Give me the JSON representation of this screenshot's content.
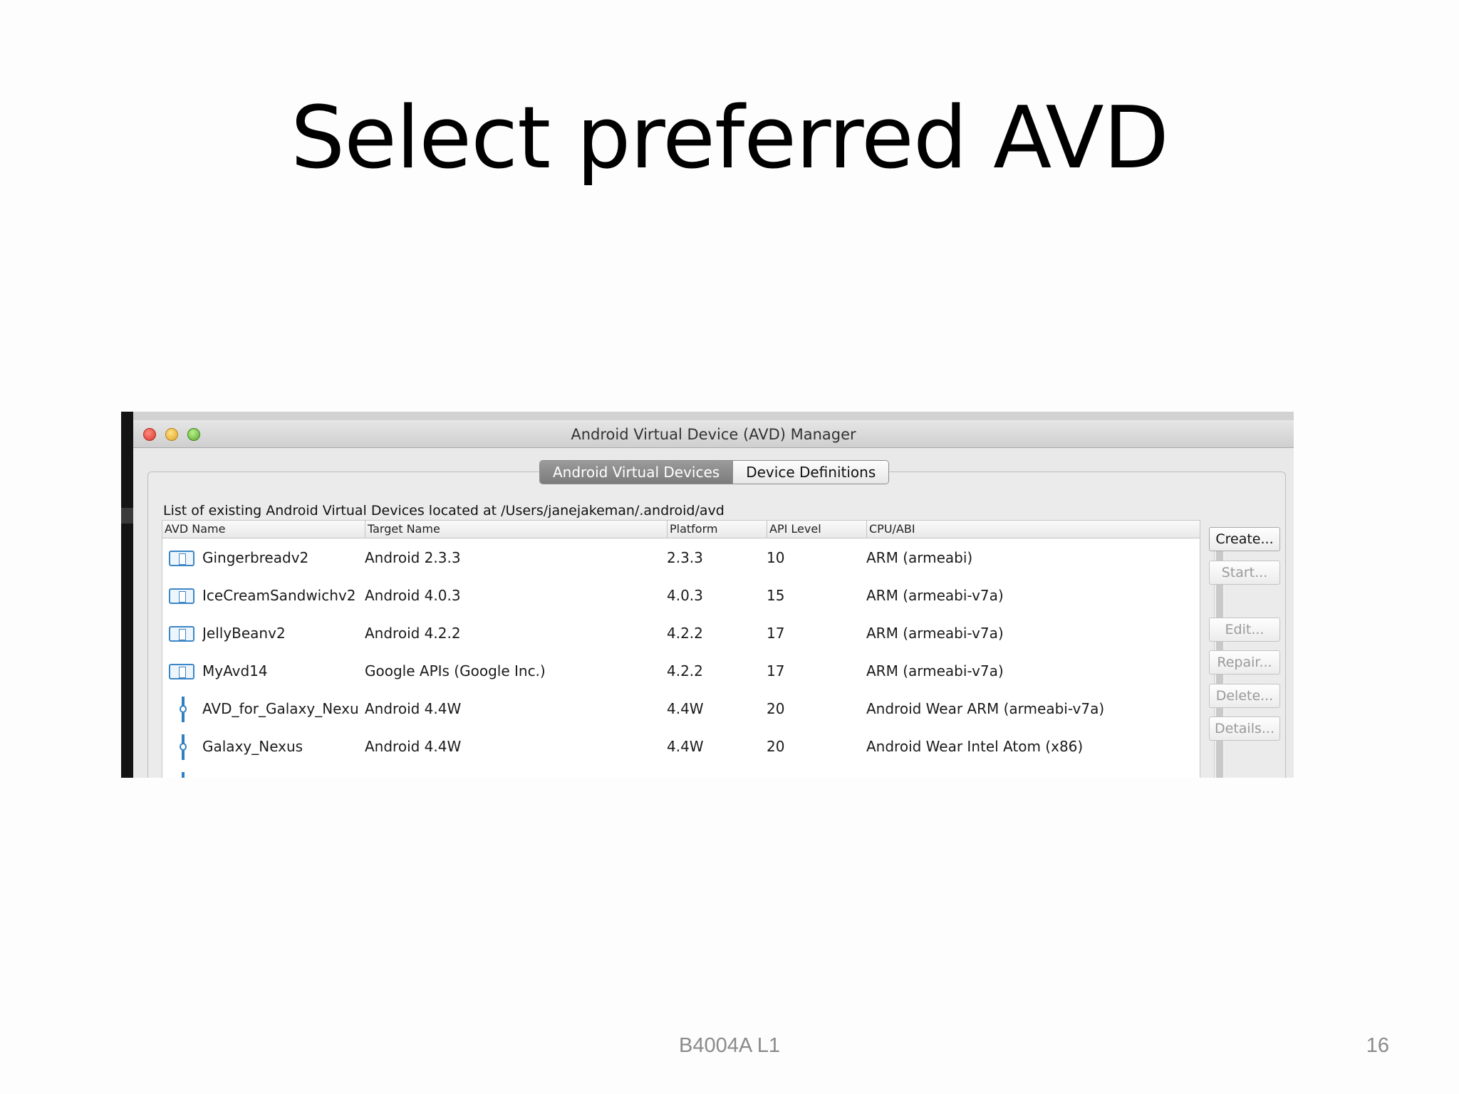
{
  "slide": {
    "title": "Select preferred AVD",
    "footer_center": "B4004A L1",
    "page_number": "16"
  },
  "window": {
    "title": "Android Virtual Device (AVD) Manager",
    "tabs": [
      {
        "label": "Android Virtual Devices",
        "active": true
      },
      {
        "label": "Device Definitions",
        "active": false
      }
    ],
    "list_caption": "List of existing Android Virtual Devices located at /Users/janejakeman/.android/avd",
    "columns": [
      "AVD Name",
      "Target Name",
      "Platform",
      "API Level",
      "CPU/ABI"
    ],
    "rows": [
      {
        "icon": "tablet-icon",
        "name": "Gingerbreadv2",
        "target": "Android 2.3.3",
        "platform": "2.3.3",
        "api": "10",
        "cpu": "ARM (armeabi)"
      },
      {
        "icon": "tablet-icon",
        "name": "IceCreamSandwichv2",
        "target": "Android 4.0.3",
        "platform": "4.0.3",
        "api": "15",
        "cpu": "ARM (armeabi-v7a)"
      },
      {
        "icon": "tablet-icon",
        "name": "JellyBeanv2",
        "target": "Android 4.2.2",
        "platform": "4.2.2",
        "api": "17",
        "cpu": "ARM (armeabi-v7a)"
      },
      {
        "icon": "tablet-icon",
        "name": "MyAvd14",
        "target": "Google APIs (Google Inc.)",
        "platform": "4.2.2",
        "api": "17",
        "cpu": "ARM (armeabi-v7a)"
      },
      {
        "icon": "wear-icon",
        "name": "AVD_for_Galaxy_Nexu",
        "target": "Android 4.4W",
        "platform": "4.4W",
        "api": "20",
        "cpu": "Android Wear ARM (armeabi-v7a)"
      },
      {
        "icon": "wear-icon",
        "name": "Galaxy_Nexus",
        "target": "Android 4.4W",
        "platform": "4.4W",
        "api": "20",
        "cpu": "Android Wear Intel Atom (x86)"
      }
    ],
    "buttons": {
      "create": "Create...",
      "start": "Start...",
      "edit": "Edit...",
      "repair": "Repair...",
      "delete": "Delete...",
      "details": "Details..."
    }
  }
}
